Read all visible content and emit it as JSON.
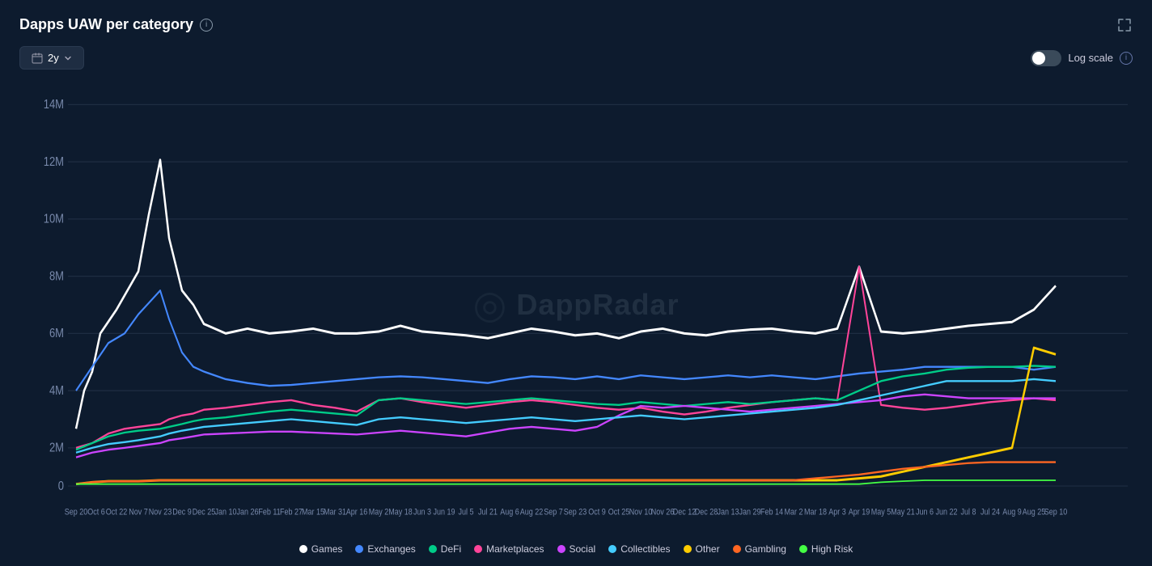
{
  "header": {
    "title": "Dapps UAW per category",
    "expand_icon": "⛶",
    "info_icon": "i"
  },
  "controls": {
    "time_period": "2y",
    "time_icon": "📅",
    "log_scale_label": "Log scale"
  },
  "chart": {
    "y_axis_labels": [
      "14M",
      "12M",
      "10M",
      "8M",
      "6M",
      "4M",
      "2M",
      "0"
    ],
    "x_axis_labels": [
      "Sep 20",
      "Oct 6",
      "Oct 22",
      "Nov 7",
      "Nov 23",
      "Dec 9",
      "Dec 25",
      "Jan 10",
      "Jan 26",
      "Feb 11",
      "Feb 27",
      "Mar 15",
      "Mar 31",
      "Apr 16",
      "May 2",
      "May 18",
      "Jun 3",
      "Jun 19",
      "Jul 5",
      "Jul 21",
      "Aug 6",
      "Aug 22",
      "Sep 7",
      "Sep 23",
      "Oct 9",
      "Oct 25",
      "Nov 10",
      "Nov 26",
      "Dec 12",
      "Dec 28",
      "Jan 13",
      "Jan 29",
      "Feb 14",
      "Mar 2",
      "Mar 18",
      "Apr 3",
      "Apr 19",
      "May 5",
      "May 21",
      "Jun 6",
      "Jun 22",
      "Jul 8",
      "Jul 24",
      "Aug 9",
      "Aug 25",
      "Sep 10"
    ]
  },
  "legend": {
    "items": [
      {
        "label": "Games",
        "color": "#ffffff"
      },
      {
        "label": "Exchanges",
        "color": "#4488ff"
      },
      {
        "label": "DeFi",
        "color": "#00cc88"
      },
      {
        "label": "Marketplaces",
        "color": "#ff4499"
      },
      {
        "label": "Social",
        "color": "#cc44ff"
      },
      {
        "label": "Collectibles",
        "color": "#44ccff"
      },
      {
        "label": "Other",
        "color": "#ffcc00"
      },
      {
        "label": "Gambling",
        "color": "#ff6622"
      },
      {
        "label": "High Risk",
        "color": "#44ff44"
      }
    ]
  },
  "watermark": {
    "logo": "◎",
    "text": "DappRadar"
  }
}
